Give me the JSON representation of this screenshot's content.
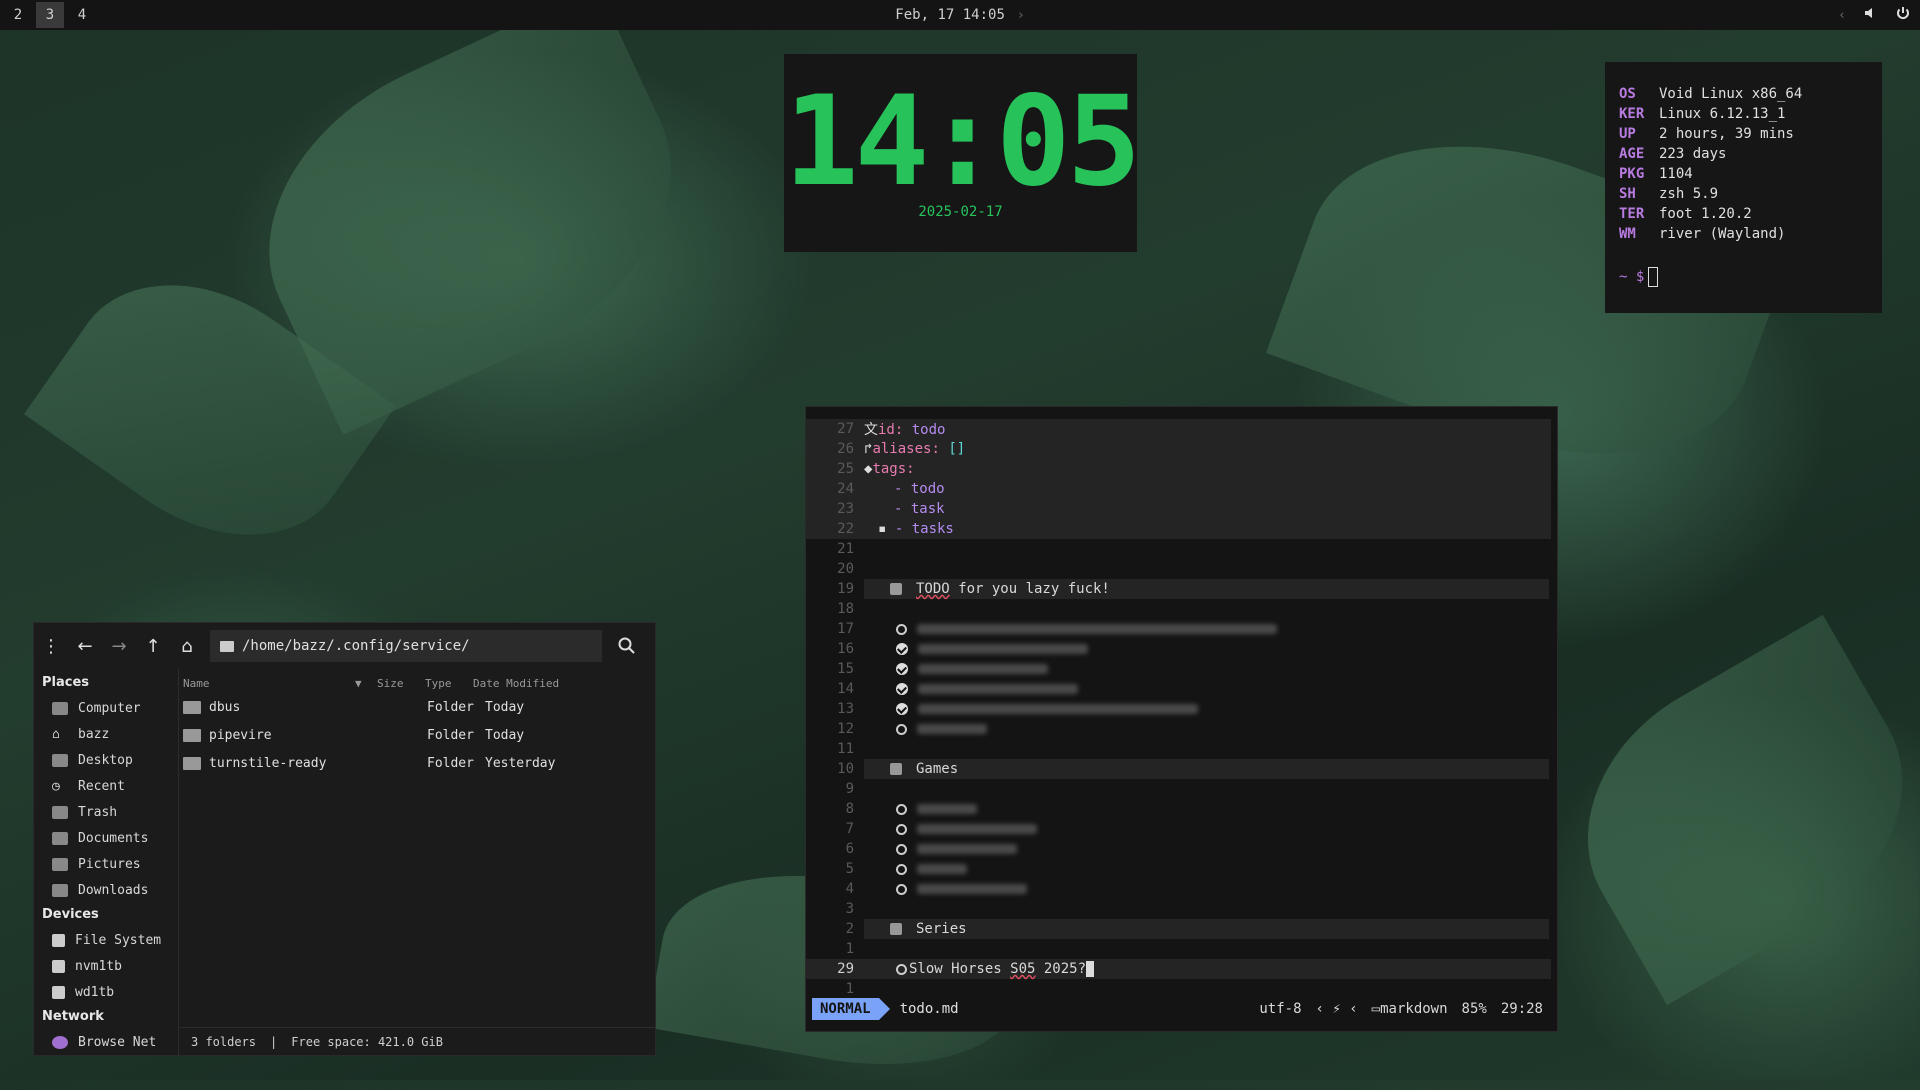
{
  "topbar": {
    "workspaces": [
      "2",
      "3",
      "4"
    ],
    "active_workspace": "3",
    "datetime": "Feb, 17 14:05",
    "icons": [
      "chevron-left-icon",
      "volume-icon",
      "power-icon"
    ]
  },
  "clock_widget": {
    "time": "14:05",
    "date": "2025-02-17",
    "color": "#27c25a"
  },
  "fetch": {
    "rows": [
      {
        "key": "OS",
        "value": "Void Linux x86_64"
      },
      {
        "key": "KER",
        "value": "Linux 6.12.13_1"
      },
      {
        "key": "UP",
        "value": "2 hours, 39 mins"
      },
      {
        "key": "AGE",
        "value": "223 days"
      },
      {
        "key": "PKG",
        "value": "1104"
      },
      {
        "key": "SH",
        "value": "zsh 5.9"
      },
      {
        "key": "TER",
        "value": "foot 1.20.2"
      },
      {
        "key": "WM",
        "value": "river (Wayland)"
      }
    ],
    "prompt": "~ $"
  },
  "editor": {
    "frontmatter": {
      "id_key": "id:",
      "id_value": "todo",
      "aliases_key": "aliases:",
      "aliases_value": "[]",
      "tags_key": "tags:",
      "tags": [
        "- todo",
        "- task",
        "- tasks"
      ]
    },
    "line_numbers": [
      "27",
      "26",
      "25",
      "24",
      "23",
      "22",
      "21",
      "20",
      "19",
      "18",
      "17",
      "16",
      "15",
      "14",
      "13",
      "12",
      "11",
      "10",
      "9",
      "8",
      "7",
      "6",
      "5",
      "4",
      "3",
      "2",
      "1",
      "29",
      "1"
    ],
    "sections": {
      "todo_heading_word": "TODO",
      "todo_heading_rest": " for you lazy fuck!",
      "games": "Games",
      "series": "Series"
    },
    "current_line_text_a": "Slow Horses ",
    "current_line_text_b": "S05",
    "current_line_text_c": " 2025?",
    "status": {
      "mode": "NORMAL",
      "file": "todo.md",
      "encoding": "utf-8",
      "filetype": "markdown",
      "percent": "85%",
      "position": "29:28"
    },
    "mode_color": "#7aa2f7"
  },
  "file_manager": {
    "path": "/home/bazz/.config/service/",
    "places_heading": "Places",
    "places": [
      "Computer",
      "bazz",
      "Desktop",
      "Recent",
      "Trash",
      "Documents",
      "Pictures",
      "Downloads"
    ],
    "devices_heading": "Devices",
    "devices": [
      "File System",
      "nvm1tb",
      "wd1tb"
    ],
    "network_heading": "Network",
    "network": [
      "Browse Net"
    ],
    "columns": {
      "name": "Name",
      "size": "Size",
      "type": "Type",
      "modified": "Date Modified"
    },
    "files": [
      {
        "name": "dbus",
        "type": "Folder",
        "modified": "Today"
      },
      {
        "name": "pipevire",
        "type": "Folder",
        "modified": "Today"
      },
      {
        "name": "turnstile-ready",
        "type": "Folder",
        "modified": "Yesterday"
      }
    ],
    "status_count": "3 folders",
    "status_sep": "|",
    "status_free": "Free space: 421.0 GiB"
  }
}
